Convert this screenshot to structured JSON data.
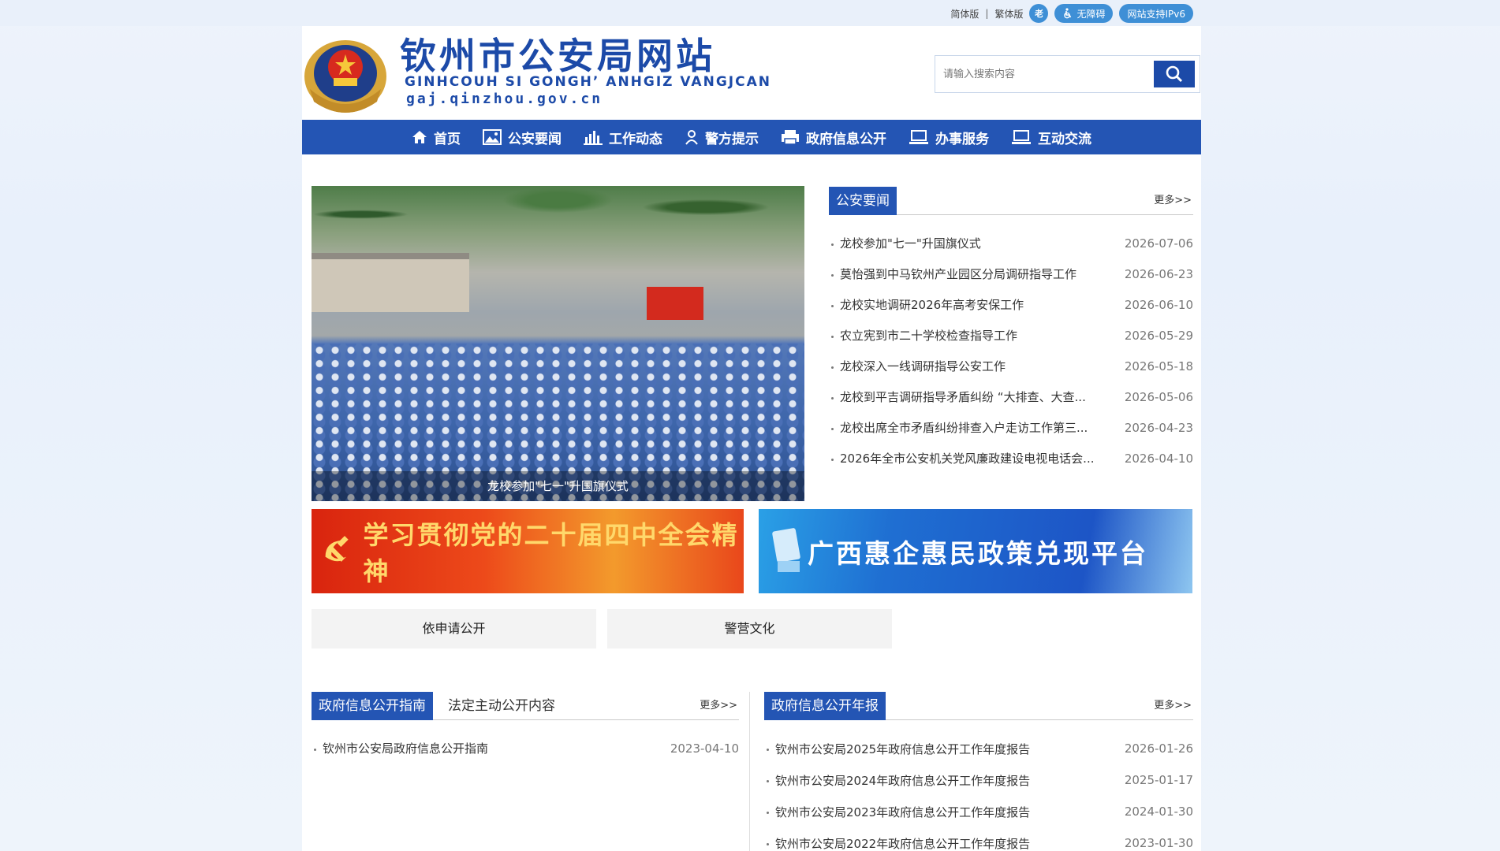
{
  "topbar": {
    "simplified": "简体版",
    "separator": "|",
    "traditional": "繁体版",
    "elder_icon": "老",
    "accessibility": "无障碍",
    "ipv6": "网站支持IPv6"
  },
  "header": {
    "title": "钦州市公安局网站",
    "subtitle": "GINHCOUH SI GONGH’ ANHGIZ VANGJCAN",
    "url": "gaj.qinzhou.gov.cn"
  },
  "search": {
    "placeholder": "请输入搜索内容"
  },
  "nav": [
    {
      "label": "首页",
      "icon": "home-icon"
    },
    {
      "label": "公安要闻",
      "icon": "image-icon"
    },
    {
      "label": "工作动态",
      "icon": "bar-chart-icon"
    },
    {
      "label": "警方提示",
      "icon": "user-icon"
    },
    {
      "label": "政府信息公开",
      "icon": "printer-icon"
    },
    {
      "label": "办事服务",
      "icon": "laptop-icon"
    },
    {
      "label": "互动交流",
      "icon": "laptop-icon"
    }
  ],
  "slideshow": {
    "caption": "龙校参加\"七一\"升国旗仪式"
  },
  "news": {
    "tab": "公安要闻",
    "more": "更多>>",
    "items": [
      {
        "title": "龙校参加\"七一\"升国旗仪式",
        "date": "2026-07-06"
      },
      {
        "title": "莫怡强到中马钦州产业园区分局调研指导工作",
        "date": "2026-06-23"
      },
      {
        "title": "龙校实地调研2026年高考安保工作",
        "date": "2026-06-10"
      },
      {
        "title": "农立宪到市二十学校检查指导工作",
        "date": "2026-05-29"
      },
      {
        "title": "龙校深入一线调研指导公安工作",
        "date": "2026-05-18"
      },
      {
        "title": "龙校到平吉调研指导矛盾纠纷 “大排查、大查...",
        "date": "2026-05-06"
      },
      {
        "title": "龙校出席全市矛盾纠纷排查入户走访工作第三...",
        "date": "2026-04-23"
      },
      {
        "title": "2026年全市公安机关党风廉政建设电视电话会...",
        "date": "2026-04-10"
      }
    ]
  },
  "banners": {
    "left": "学习贯彻党的二十届四中全会精神",
    "right": "广西惠企惠民政策兑现平台"
  },
  "quick_links": [
    "依申请公开",
    "警营文化"
  ],
  "guide": {
    "tab": "政府信息公开指南",
    "tab2": "法定主动公开内容",
    "more": "更多>>",
    "items": [
      {
        "title": "钦州市公安局政府信息公开指南",
        "date": "2023-04-10"
      }
    ]
  },
  "annual": {
    "tab": "政府信息公开年报",
    "more": "更多>>",
    "items": [
      {
        "title": "钦州市公安局2025年政府信息公开工作年度报告",
        "date": "2026-01-26"
      },
      {
        "title": "钦州市公安局2024年政府信息公开工作年度报告",
        "date": "2025-01-17"
      },
      {
        "title": "钦州市公安局2023年政府信息公开工作年度报告",
        "date": "2024-01-30"
      },
      {
        "title": "钦州市公安局2022年政府信息公开工作年度报告",
        "date": "2023-01-30"
      }
    ]
  },
  "colors": {
    "brand_blue": "#2455b4",
    "title_blue": "#1c4aa8",
    "accent_light": "#3e8fd6"
  }
}
